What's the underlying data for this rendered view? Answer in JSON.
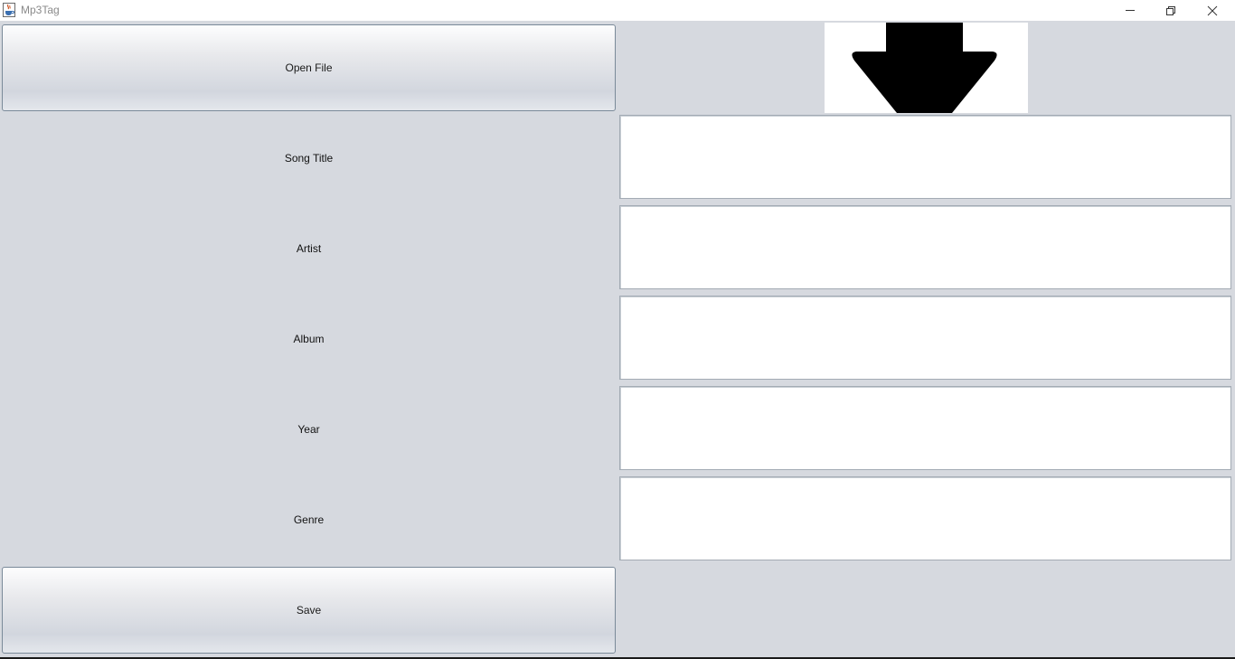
{
  "window": {
    "title": "Mp3Tag",
    "icon": "java-cup-icon",
    "controls": [
      "minimize-icon",
      "restore-icon",
      "close-icon"
    ]
  },
  "actions": {
    "open_file_label": "Open File",
    "save_label": "Save"
  },
  "fields": {
    "song_title": {
      "label": "Song Title",
      "value": ""
    },
    "artist": {
      "label": "Artist",
      "value": ""
    },
    "album": {
      "label": "Album",
      "value": ""
    },
    "year": {
      "label": "Year",
      "value": ""
    },
    "genre": {
      "label": "Genre",
      "value": ""
    }
  },
  "cover_art": {
    "icon": "down-arrow-icon"
  },
  "colors": {
    "background": "#d6d9df",
    "field_background": "#ffffff",
    "title_text": "#8a8a8a"
  }
}
